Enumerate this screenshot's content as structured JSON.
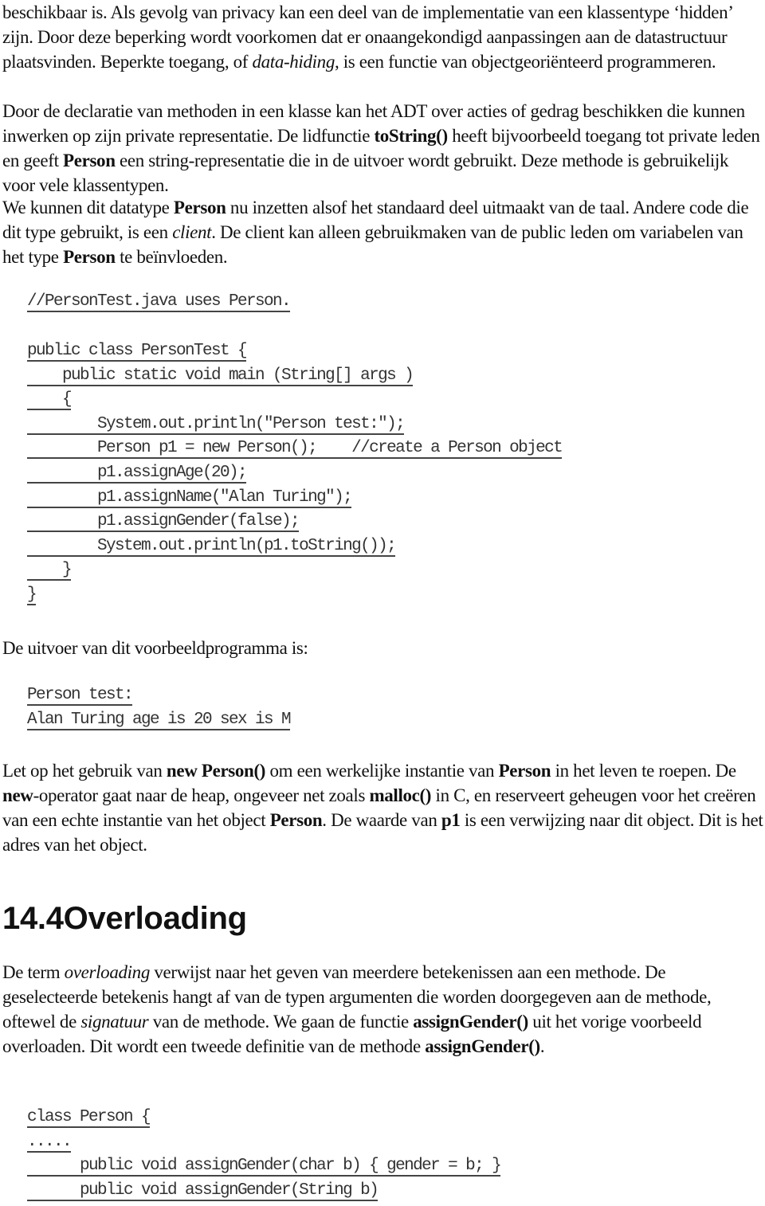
{
  "paragraphs": {
    "p1": [
      {
        "t": "beschikbaar is. Als gevolg van privacy kan een deel van de implementatie van een klassentype ‘hidden’ zijn. Door deze beperking wordt voorkomen dat er onaangekondigd aanpassingen aan de datastructuur plaatsvinden. Beperkte toegang, of "
      },
      {
        "i": "data-hiding"
      },
      {
        "t": ", is een functie van objectgeoriënteerd programmeren."
      }
    ],
    "p2": [
      {
        "t": "Door de declaratie van methoden in een klasse kan het ADT over acties of gedrag beschikken die kunnen inwerken op zijn private representatie. De lidfunctie "
      },
      {
        "b": "toString()"
      },
      {
        "t": " heeft bijvoorbeeld toegang tot private leden en geeft "
      },
      {
        "b": "Person"
      },
      {
        "t": " een string-representatie die in de uitvoer wordt gebruikt. Deze methode is gebruikelijk voor vele klassentypen."
      }
    ],
    "p3": [
      {
        "t": "We kunnen dit datatype "
      },
      {
        "b": "Person"
      },
      {
        "t": " nu inzetten alsof het standaard deel uitmaakt van de taal. Andere code die dit type gebruikt, is een "
      },
      {
        "i": "client"
      },
      {
        "t": ". De client kan alleen gebruikmaken van de public leden om variabelen van het type "
      },
      {
        "b": "Person"
      },
      {
        "t": " te beïnvloeden."
      }
    ],
    "p4": [
      {
        "t": "De uitvoer van dit voorbeeldprogramma is:"
      }
    ],
    "p5": [
      {
        "t": "Let op het gebruik van "
      },
      {
        "b": "new Person()"
      },
      {
        "t": " om een werkelijke instantie van "
      },
      {
        "b": "Person"
      },
      {
        "t": " in het leven te roepen. De "
      },
      {
        "b": "new"
      },
      {
        "t": "-operator gaat naar de heap, ongeveer net zoals "
      },
      {
        "b": "malloc()"
      },
      {
        "t": " in C, en reserveert geheugen voor het creëren van een echte instantie van het object "
      },
      {
        "b": "Person"
      },
      {
        "t": ". De waarde van "
      },
      {
        "b": "p1"
      },
      {
        "t": " is een verwijzing naar dit object. Dit is het adres van het object."
      }
    ],
    "p6": [
      {
        "t": "De term "
      },
      {
        "i": "overloading"
      },
      {
        "t": " verwijst naar het geven van meerdere betekenissen aan een methode. De geselecteerde betekenis hangt af van de typen argumenten die worden doorgegeven aan de methode, oftewel de "
      },
      {
        "i": "signatuur"
      },
      {
        "t": " van de methode. We gaan de functie "
      },
      {
        "b": "assignGender()"
      },
      {
        "t": " uit het vorige voorbeeld overloaden. Dit wordt een tweede definitie van de methode "
      },
      {
        "b": "assignGender()"
      },
      {
        "t": "."
      }
    ]
  },
  "code_comment": [
    "//PersonTest.java uses Person."
  ],
  "code_main": [
    "public class PersonTest {",
    "    public static void main (String[] args )",
    "    {",
    "        System.out.println(\"Person test:\");",
    "        Person p1 = new Person();    //create a Person object",
    "        p1.assignAge(20);",
    "        p1.assignName(\"Alan Turing\");",
    "        p1.assignGender(false);",
    "        System.out.println(p1.toString());",
    "    }",
    "}"
  ],
  "code_output": [
    "Person test:",
    "Alan Turing age is 20 sex is M"
  ],
  "section_heading": "14.4Overloading",
  "code_overload": [
    "class Person {",
    ".....",
    "      public void assignGender(char b) { gender = b; }",
    "      public void assignGender(String b)"
  ]
}
